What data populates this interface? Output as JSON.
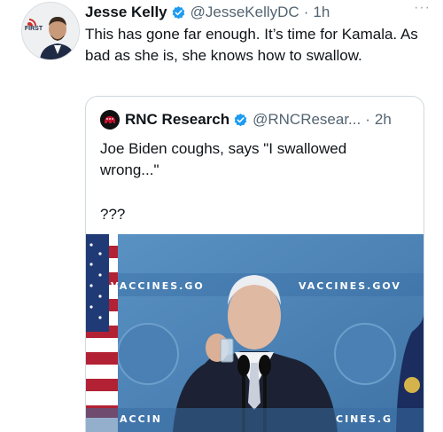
{
  "tweet": {
    "author_name": "Jesse Kelly",
    "author_handle": "@JesseKellyDC",
    "separator": "·",
    "time": "1h",
    "more_label": "···",
    "text": "This has gone far enough. It’s time for Kamala. As bad as she is, she knows how to swallow.",
    "avatar_badge": "FIRST"
  },
  "quoted": {
    "author_name": "RNC Research",
    "author_handle": "@RNCResear...",
    "separator": "·",
    "time": "2h",
    "text": "Joe Biden coughs, says \"I swallowed wrong...\"",
    "extra": "???",
    "media": {
      "banner_left": "VACCINES.GO",
      "banner_right": "VACCINES.GOV",
      "banner_bottom_left": "ACCIN",
      "banner_bottom_right": "CINES.G"
    }
  },
  "colors": {
    "verified": "#1d9bf0",
    "text_primary": "#0f1419",
    "text_secondary": "#536471",
    "border": "#cfd9de",
    "backdrop_blue": "#4f86b8"
  },
  "icons": [
    "verified-badge-icon",
    "more-options-icon",
    "rnc-elephant-icon"
  ]
}
